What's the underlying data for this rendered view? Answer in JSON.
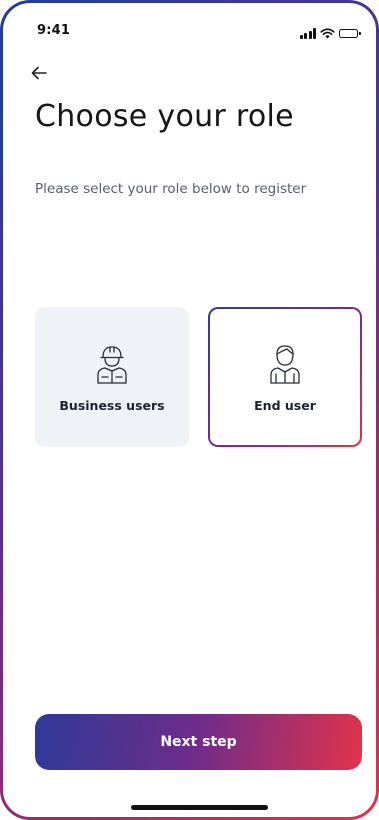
{
  "status_bar": {
    "time": "9:41",
    "icons": [
      "signal-icon",
      "wifi-icon",
      "battery-icon"
    ]
  },
  "header": {
    "back_icon": "arrow-left-icon",
    "title": "Choose your role",
    "subtitle": "Please select your role below to register"
  },
  "roles": [
    {
      "label": "Business users",
      "icon": "worker-helmet-icon",
      "selected": false,
      "background": "#eff2f6"
    },
    {
      "label": "End user",
      "icon": "user-icon",
      "selected": true,
      "border_gradient": [
        "#2e3c9a",
        "#7a2c86",
        "#e1324a"
      ]
    }
  ],
  "footer": {
    "next_label": "Next step",
    "button_gradient": [
      "#2e3a97",
      "#702c8a",
      "#e2334a"
    ]
  }
}
